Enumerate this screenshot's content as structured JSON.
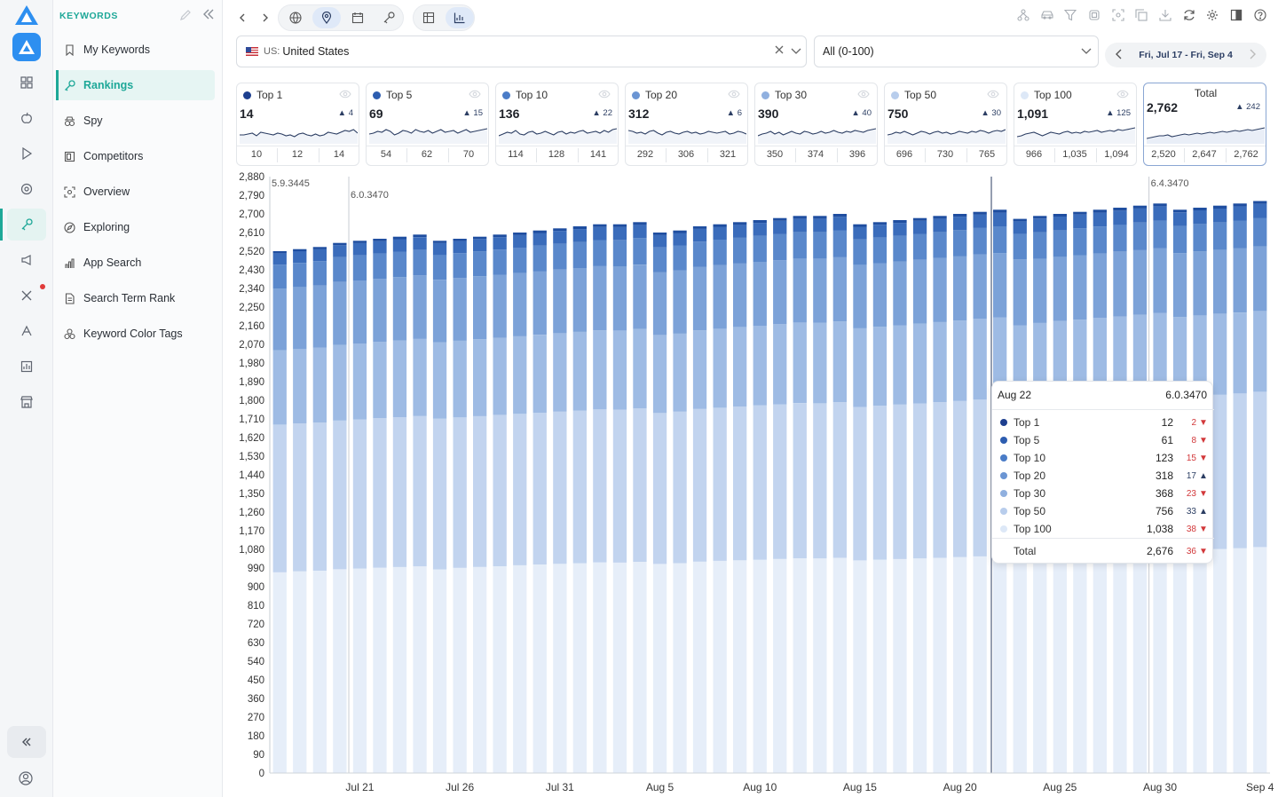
{
  "sidebar": {
    "title": "KEYWORDS",
    "items": [
      {
        "label": "My Keywords",
        "icon": "bookmark-icon"
      },
      {
        "label": "Rankings",
        "icon": "key-icon",
        "active": true
      },
      {
        "label": "Spy",
        "icon": "spy-icon"
      },
      {
        "label": "Competitors",
        "icon": "competitors-icon"
      },
      {
        "label": "Overview",
        "icon": "overview-icon"
      },
      {
        "label": "Exploring",
        "icon": "compass-icon"
      },
      {
        "label": "App Search",
        "icon": "bar-chart-icon"
      },
      {
        "label": "Search Term Rank",
        "icon": "document-icon"
      },
      {
        "label": "Keyword Color Tags",
        "icon": "color-tags-icon"
      }
    ]
  },
  "filters": {
    "country_prefix": "US:",
    "country": "United States",
    "range": "All (0-100)",
    "date_range": "Fri, Jul 17 - Fri, Sep 4"
  },
  "cards": [
    {
      "label": "Top 1",
      "value": "14",
      "delta": "4",
      "color": "#1d3f8f",
      "ticks": [
        "10",
        "12",
        "14"
      ]
    },
    {
      "label": "Top 5",
      "value": "69",
      "delta": "15",
      "color": "#2d5db0",
      "ticks": [
        "54",
        "62",
        "70"
      ]
    },
    {
      "label": "Top 10",
      "value": "136",
      "delta": "22",
      "color": "#4a7cc7",
      "ticks": [
        "114",
        "128",
        "141"
      ]
    },
    {
      "label": "Top 20",
      "value": "312",
      "delta": "6",
      "color": "#6b95d3",
      "ticks": [
        "292",
        "306",
        "321"
      ]
    },
    {
      "label": "Top 30",
      "value": "390",
      "delta": "40",
      "color": "#90b0df",
      "ticks": [
        "350",
        "374",
        "396"
      ]
    },
    {
      "label": "Top 50",
      "value": "750",
      "delta": "30",
      "color": "#b8cdec",
      "ticks": [
        "696",
        "730",
        "765"
      ]
    },
    {
      "label": "Top 100",
      "value": "1,091",
      "delta": "125",
      "color": "#dde8f7",
      "ticks": [
        "966",
        "1,035",
        "1,094"
      ]
    },
    {
      "label": "Total",
      "value": "2,762",
      "delta": "242",
      "color": "#2c3e63",
      "ticks": [
        "2,520",
        "2,647",
        "2,762"
      ]
    }
  ],
  "tooltip": {
    "date": "Aug 22",
    "version": "6.0.3470",
    "rows": [
      {
        "label": "Top 1",
        "value": "12",
        "delta": "2",
        "dir": "down",
        "color": "#1d3f8f"
      },
      {
        "label": "Top 5",
        "value": "61",
        "delta": "8",
        "dir": "down",
        "color": "#2d5db0"
      },
      {
        "label": "Top 10",
        "value": "123",
        "delta": "15",
        "dir": "down",
        "color": "#4a7cc7"
      },
      {
        "label": "Top 20",
        "value": "318",
        "delta": "17",
        "dir": "up",
        "color": "#6b95d3"
      },
      {
        "label": "Top 30",
        "value": "368",
        "delta": "23",
        "dir": "down",
        "color": "#90b0df"
      },
      {
        "label": "Top 50",
        "value": "756",
        "delta": "33",
        "dir": "up",
        "color": "#b8cdec"
      },
      {
        "label": "Top 100",
        "value": "1,038",
        "delta": "38",
        "dir": "down",
        "color": "#dde8f7"
      }
    ],
    "total_label": "Total",
    "total_value": "2,676",
    "total_delta": "36",
    "total_dir": "down"
  },
  "chart_data": {
    "type": "bar",
    "stacked": true,
    "ylim": [
      0,
      2880
    ],
    "yticks": [
      "2,880",
      "2,790",
      "2,700",
      "2,610",
      "2,520",
      "2,430",
      "2,340",
      "2,250",
      "2,160",
      "2,070",
      "1,980",
      "1,890",
      "1,800",
      "1,710",
      "1,620",
      "1,530",
      "1,440",
      "1,350",
      "1,260",
      "1,170",
      "1,080",
      "990",
      "900",
      "810",
      "720",
      "630",
      "540",
      "450",
      "360",
      "270",
      "180",
      "90",
      "0"
    ],
    "xticks": [
      {
        "label": "Jul 21",
        "index": 4
      },
      {
        "label": "Jul 26",
        "index": 9
      },
      {
        "label": "Jul 31",
        "index": 14
      },
      {
        "label": "Aug 5",
        "index": 19
      },
      {
        "label": "Aug 10",
        "index": 24
      },
      {
        "label": "Aug 15",
        "index": 29
      },
      {
        "label": "Aug 20",
        "index": 34
      },
      {
        "label": "Aug 25",
        "index": 39
      },
      {
        "label": "Aug 30",
        "index": 44
      },
      {
        "label": "Sep 4",
        "index": 49
      }
    ],
    "annotations": [
      {
        "label": "5.9.3445",
        "index": 0
      },
      {
        "label": "6.0.3470",
        "index": 3
      },
      {
        "label": "6.4.3470",
        "index": 43
      }
    ],
    "cursor_index": 36,
    "series_names": [
      "Top 1",
      "Top 5",
      "Top 10",
      "Top 20",
      "Top 30",
      "Top 50",
      "Top 100"
    ],
    "series_colors": [
      "#1d3f8f",
      "#2d5db0",
      "#4a7cc7",
      "#6b95d3",
      "#90b0df",
      "#b8cdec",
      "#e6eef9"
    ],
    "totals": [
      2520,
      2530,
      2540,
      2560,
      2570,
      2580,
      2590,
      2600,
      2570,
      2580,
      2590,
      2600,
      2610,
      2620,
      2630,
      2640,
      2650,
      2650,
      2660,
      2610,
      2620,
      2640,
      2650,
      2660,
      2670,
      2680,
      2690,
      2690,
      2700,
      2650,
      2660,
      2670,
      2680,
      2690,
      2700,
      2710,
      2720,
      2676,
      2690,
      2700,
      2710,
      2720,
      2730,
      2740,
      2750,
      2720,
      2730,
      2740,
      2750,
      2762
    ],
    "top100": [
      952,
      958,
      962,
      966,
      970,
      974,
      978,
      982,
      960,
      970,
      975,
      980,
      985,
      988,
      992,
      996,
      1000,
      1002,
      1004,
      990,
      995,
      1000,
      1005,
      1008,
      1012,
      1016,
      1020,
      1022,
      1024,
      1005,
      1010,
      1015,
      1018,
      1022,
      1026,
      1030,
      1034,
      1038,
      1045,
      1052,
      1058,
      1064,
      1070,
      1076,
      1082,
      1070,
      1076,
      1082,
      1086,
      1091
    ],
    "top50": [
      700,
      702,
      704,
      706,
      708,
      710,
      712,
      714,
      710,
      712,
      714,
      716,
      718,
      720,
      722,
      724,
      726,
      728,
      730,
      715,
      718,
      722,
      725,
      728,
      731,
      734,
      737,
      739,
      741,
      725,
      729,
      733,
      736,
      739,
      742,
      745,
      748,
      756,
      740,
      743,
      746,
      749,
      752,
      755,
      758,
      740,
      744,
      746,
      748,
      750
    ],
    "top30": [
      352,
      354,
      356,
      358,
      360,
      362,
      364,
      366,
      360,
      362,
      364,
      366,
      368,
      370,
      372,
      374,
      376,
      377,
      378,
      368,
      370,
      372,
      374,
      376,
      378,
      380,
      382,
      383,
      384,
      372,
      374,
      376,
      378,
      380,
      382,
      384,
      386,
      368,
      390,
      391,
      392,
      393,
      394,
      395,
      396,
      388,
      389,
      390,
      390,
      390
    ],
    "top20": [
      292,
      294,
      296,
      298,
      299,
      300,
      301,
      302,
      296,
      297,
      298,
      299,
      300,
      301,
      302,
      303,
      304,
      305,
      306,
      298,
      299,
      300,
      301,
      302,
      303,
      304,
      305,
      306,
      307,
      300,
      301,
      302,
      303,
      304,
      305,
      306,
      307,
      318,
      310,
      311,
      312,
      313,
      314,
      315,
      316,
      308,
      309,
      310,
      311,
      312
    ],
    "top10": [
      114,
      115,
      116,
      118,
      119,
      120,
      121,
      122,
      116,
      117,
      118,
      119,
      120,
      121,
      122,
      123,
      124,
      125,
      126,
      118,
      119,
      120,
      121,
      122,
      123,
      124,
      125,
      126,
      127,
      120,
      121,
      122,
      123,
      124,
      125,
      126,
      127,
      123,
      128,
      129,
      130,
      131,
      132,
      133,
      134,
      130,
      131,
      132,
      134,
      136
    ],
    "top5": [
      54,
      55,
      56,
      57,
      58,
      58,
      59,
      60,
      56,
      57,
      58,
      59,
      60,
      60,
      61,
      62,
      62,
      63,
      63,
      58,
      59,
      60,
      61,
      61,
      62,
      63,
      63,
      64,
      64,
      60,
      61,
      62,
      62,
      63,
      64,
      64,
      65,
      61,
      66,
      66,
      67,
      67,
      68,
      68,
      69,
      66,
      67,
      67,
      68,
      69
    ],
    "top1": [
      10,
      10,
      11,
      11,
      11,
      12,
      12,
      12,
      11,
      11,
      11,
      12,
      12,
      12,
      12,
      13,
      13,
      13,
      13,
      12,
      12,
      12,
      12,
      13,
      13,
      13,
      13,
      13,
      14,
      12,
      12,
      13,
      13,
      13,
      13,
      13,
      14,
      12,
      13,
      13,
      13,
      14,
      14,
      14,
      14,
      13,
      13,
      14,
      14,
      14
    ]
  }
}
